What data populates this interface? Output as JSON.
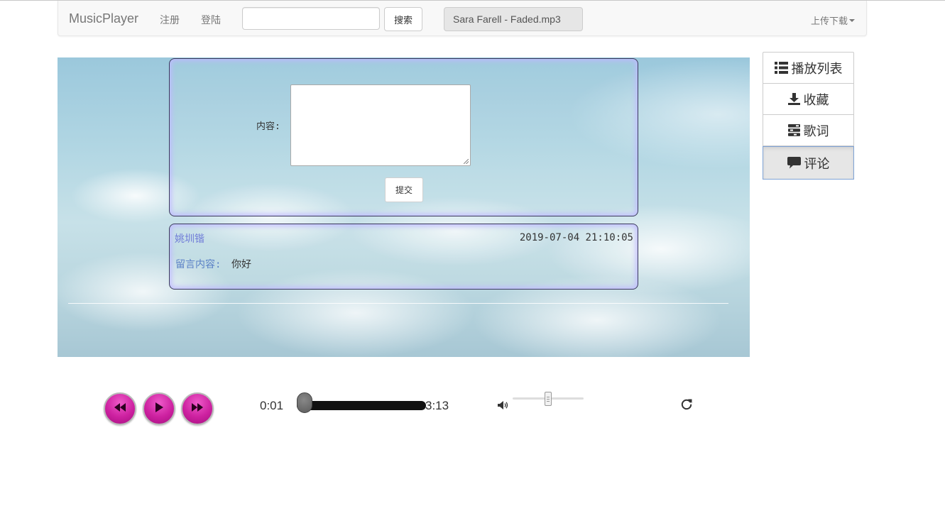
{
  "navbar": {
    "brand": "MusicPlayer",
    "register": "注册",
    "login": "登陆",
    "search_value": "",
    "search_button": "搜索",
    "now_playing": "Sara Farell - Faded.mp3",
    "upload_download": "上传下载"
  },
  "comment_form": {
    "content_label": "内容:",
    "content_value": "",
    "submit_label": "提交"
  },
  "comments": [
    {
      "user": "姚圳锴",
      "time": "2019-07-04 21:10:05",
      "content_label": "留言内容:",
      "content": "你好"
    }
  ],
  "side_tabs": [
    {
      "label": "播放列表",
      "icon": "list-icon",
      "active": false
    },
    {
      "label": "收藏",
      "icon": "download-icon",
      "active": false
    },
    {
      "label": "歌词",
      "icon": "tasks-icon",
      "active": false
    },
    {
      "label": "评论",
      "icon": "comment-icon",
      "active": true
    }
  ],
  "player": {
    "current_time": "0:01",
    "total_time": "3:13",
    "progress_fraction": 0.005,
    "volume_fraction": 0.5,
    "buttons": [
      "prev-icon",
      "play-icon",
      "next-icon"
    ]
  },
  "colors": {
    "player_button": "#cd21a0",
    "panel_glow": "#bebaff",
    "comment_user": "#6f7bd8",
    "comment_label": "#5a80c6",
    "active_tab_border": "#7fa3d6"
  }
}
